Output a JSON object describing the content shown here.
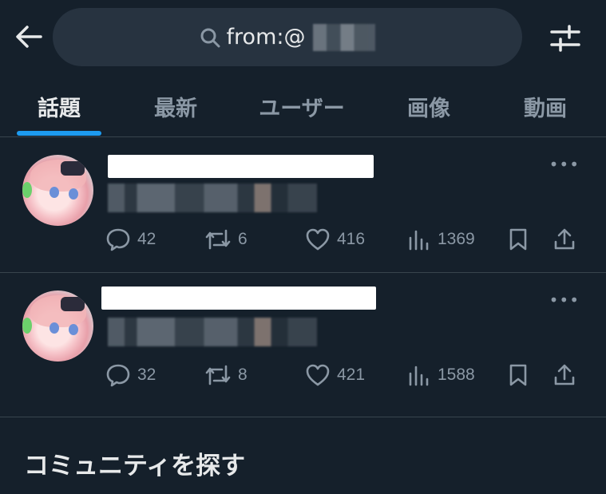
{
  "search": {
    "query": "from:@"
  },
  "tabs": [
    {
      "label": "話題",
      "active": true
    },
    {
      "label": "最新",
      "active": false
    },
    {
      "label": "ユーザー",
      "active": false
    },
    {
      "label": "画像",
      "active": false
    },
    {
      "label": "動画",
      "active": false
    }
  ],
  "posts": [
    {
      "replies": "42",
      "reposts": "6",
      "likes": "416",
      "views": "1369"
    },
    {
      "replies": "32",
      "reposts": "8",
      "likes": "421",
      "views": "1588"
    }
  ],
  "section": {
    "title": "コミュニティを探す"
  },
  "colors": {
    "background": "#15202b",
    "accent": "#1d9bf0",
    "muted": "#8b98a5",
    "search_bg": "#273340",
    "divider": "#38444d"
  },
  "icons": [
    "back-arrow-icon",
    "search-icon",
    "filter-sliders-icon",
    "more-icon",
    "reply-icon",
    "repost-icon",
    "like-icon",
    "views-icon",
    "bookmark-icon",
    "share-icon"
  ]
}
